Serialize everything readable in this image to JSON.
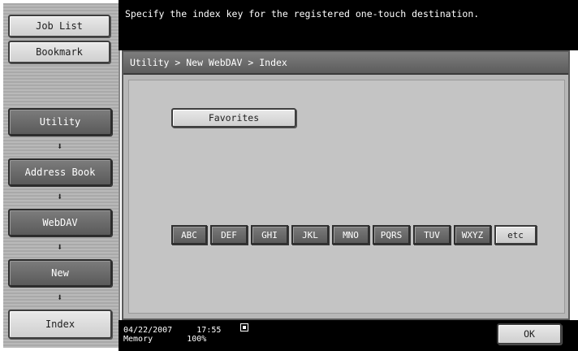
{
  "sidebar": {
    "job_list": "Job List",
    "bookmark": "Bookmark",
    "steps": [
      "Utility",
      "Address Book",
      "WebDAV",
      "New",
      "Index"
    ],
    "arrow": "⬇"
  },
  "header": {
    "message": "Specify the index key for the registered one-touch destination."
  },
  "panel": {
    "breadcrumb": "Utility > New WebDAV > Index",
    "favorites": "Favorites",
    "keys": [
      "ABC",
      "DEF",
      "GHI",
      "JKL",
      "MNO",
      "PQRS",
      "TUV",
      "WXYZ",
      "etc"
    ],
    "selected_key": "etc"
  },
  "footer": {
    "date": "04/22/2007",
    "time": "17:55",
    "memory_label": "Memory",
    "memory_value": "100%",
    "ok": "OK"
  }
}
